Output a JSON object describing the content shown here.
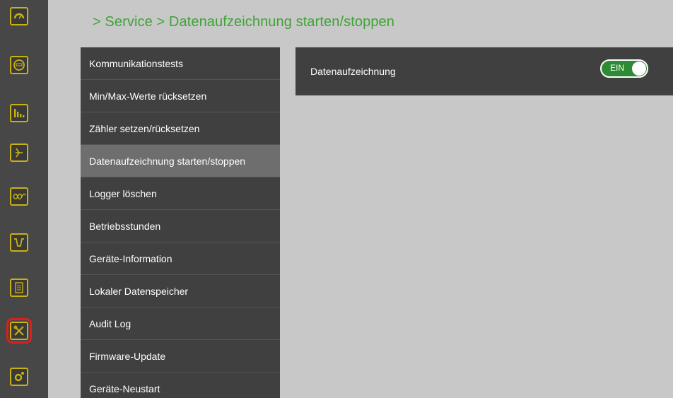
{
  "breadcrumb": "> Service > Datenaufzeichnung starten/stoppen",
  "rail": {
    "icons": [
      "gauge-icon",
      "meter-icon",
      "bar-chart-icon",
      "phasor-icon",
      "waveform-icon",
      "dip-icon",
      "report-icon",
      "tools-icon",
      "settings-icon"
    ],
    "accent": "#c9b112",
    "highlight": "#d82020"
  },
  "submenu": {
    "items": [
      {
        "label": "Kommunikationstests"
      },
      {
        "label": "Min/Max-Werte rücksetzen"
      },
      {
        "label": "Zähler setzen/rücksetzen"
      },
      {
        "label": "Datenaufzeichnung starten/stoppen"
      },
      {
        "label": "Logger löschen"
      },
      {
        "label": "Betriebsstunden"
      },
      {
        "label": "Geräte-Information"
      },
      {
        "label": "Lokaler Datenspeicher"
      },
      {
        "label": "Audit Log"
      },
      {
        "label": "Firmware-Update"
      },
      {
        "label": "Geräte-Neustart"
      }
    ],
    "active_index": 3
  },
  "panel": {
    "label": "Datenaufzeichnung",
    "toggle_label": "EIN",
    "toggle_state": "on",
    "toggle_color": "#2e8b35"
  }
}
